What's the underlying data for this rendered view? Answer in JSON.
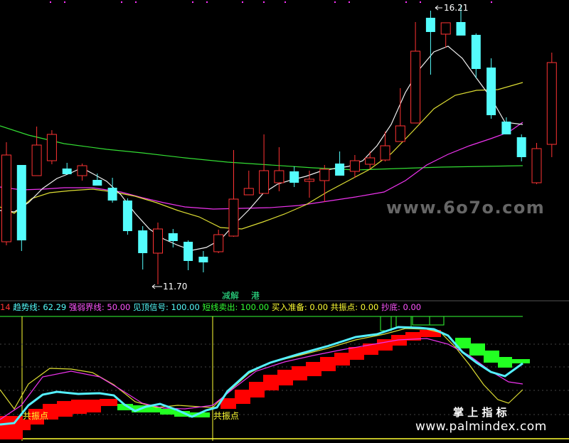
{
  "chart_data": [
    {
      "type": "candlestick",
      "panel": "price",
      "candles": [
        {
          "o": 340,
          "h": 345,
          "l": 200,
          "c": 218
        },
        {
          "o": 232,
          "h": 232,
          "l": 353,
          "c": 338
        },
        {
          "o": 247,
          "h": 178,
          "l": 247,
          "c": 204
        },
        {
          "o": 226,
          "h": 183,
          "l": 231,
          "c": 189
        },
        {
          "o": 237,
          "h": 229,
          "l": 245,
          "c": 245
        },
        {
          "o": 247,
          "h": 230,
          "l": 254,
          "c": 233
        },
        {
          "o": 253,
          "h": 244,
          "l": 261,
          "c": 261
        },
        {
          "o": 264,
          "h": 250,
          "l": 285,
          "c": 282
        },
        {
          "o": 282,
          "h": 279,
          "l": 330,
          "c": 325
        },
        {
          "o": 324,
          "h": 318,
          "l": 379,
          "c": 356
        },
        {
          "o": 356,
          "h": 313,
          "l": 400,
          "c": 322
        },
        {
          "o": 328,
          "h": 322,
          "l": 348,
          "c": 339
        },
        {
          "o": 340,
          "h": 338,
          "l": 380,
          "c": 367
        },
        {
          "o": 361,
          "h": 353,
          "l": 383,
          "c": 369
        },
        {
          "o": 354,
          "h": 323,
          "l": 356,
          "c": 330
        },
        {
          "o": 332,
          "h": 211,
          "l": 333,
          "c": 280
        },
        {
          "o": 274,
          "h": 240,
          "l": 274,
          "c": 265
        },
        {
          "o": 272,
          "h": 189,
          "l": 272,
          "c": 240
        },
        {
          "o": 257,
          "h": 207,
          "l": 269,
          "c": 240
        },
        {
          "o": 241,
          "h": 234,
          "l": 263,
          "c": 257
        },
        {
          "o": 255,
          "h": 240,
          "l": 278,
          "c": 252
        },
        {
          "o": 254,
          "h": 232,
          "l": 284,
          "c": 238
        },
        {
          "o": 230,
          "h": 213,
          "l": 247,
          "c": 247
        },
        {
          "o": 241,
          "h": 218,
          "l": 250,
          "c": 226
        },
        {
          "o": 231,
          "h": 213,
          "l": 238,
          "c": 222
        },
        {
          "o": 225,
          "h": 185,
          "l": 227,
          "c": 205
        },
        {
          "o": 199,
          "h": 124,
          "l": 199,
          "c": 177
        },
        {
          "o": 173,
          "h": 31,
          "l": 173,
          "c": 72
        },
        {
          "o": 25,
          "h": 15,
          "l": 105,
          "c": 45
        },
        {
          "o": 48,
          "h": 32,
          "l": 67,
          "c": 32
        },
        {
          "o": 31,
          "h": 7,
          "l": 49,
          "c": 50
        },
        {
          "o": 49,
          "h": 47,
          "l": 110,
          "c": 97
        },
        {
          "o": 95,
          "h": 82,
          "l": 167,
          "c": 162
        },
        {
          "o": 171,
          "h": 165,
          "l": 189,
          "c": 189
        },
        {
          "o": 193,
          "h": 189,
          "l": 227,
          "c": 221
        },
        {
          "o": 257,
          "h": 201,
          "l": 259,
          "c": 209
        },
        {
          "o": 203,
          "h": 74,
          "l": 221,
          "c": 88
        }
      ],
      "up_color": "#ff3333",
      "down_color": "#54fcfc",
      "annotations": {
        "high": "16.21",
        "low": "11.70"
      },
      "tags": [
        "减解",
        "港"
      ],
      "watermark": "www.6o7o.com"
    },
    {
      "type": "indicator",
      "panel": "lower",
      "legend": [
        {
          "label": "14",
          "color": "#ff3333"
        },
        {
          "label": "趋势线: 62.29",
          "color": "#54fcfc"
        },
        {
          "label": "强弱界线: 50.00",
          "color": "#ff55ff"
        },
        {
          "label": "见顶信号: 100.00",
          "color": "#54fcfc"
        },
        {
          "label": "短线卖出: 100.00",
          "color": "#33ff33"
        },
        {
          "label": "买入准备: 0.00",
          "color": "#ffff33"
        },
        {
          "label": "共振点: 0.00",
          "color": "#ffff33"
        },
        {
          "label": "抄底: 0.00",
          "color": "#ff55ff"
        }
      ],
      "markers": [
        "共振点",
        "共振点"
      ],
      "watermark": {
        "line1": "掌 上 指 标",
        "line2": "www.palmindex.com"
      }
    }
  ]
}
